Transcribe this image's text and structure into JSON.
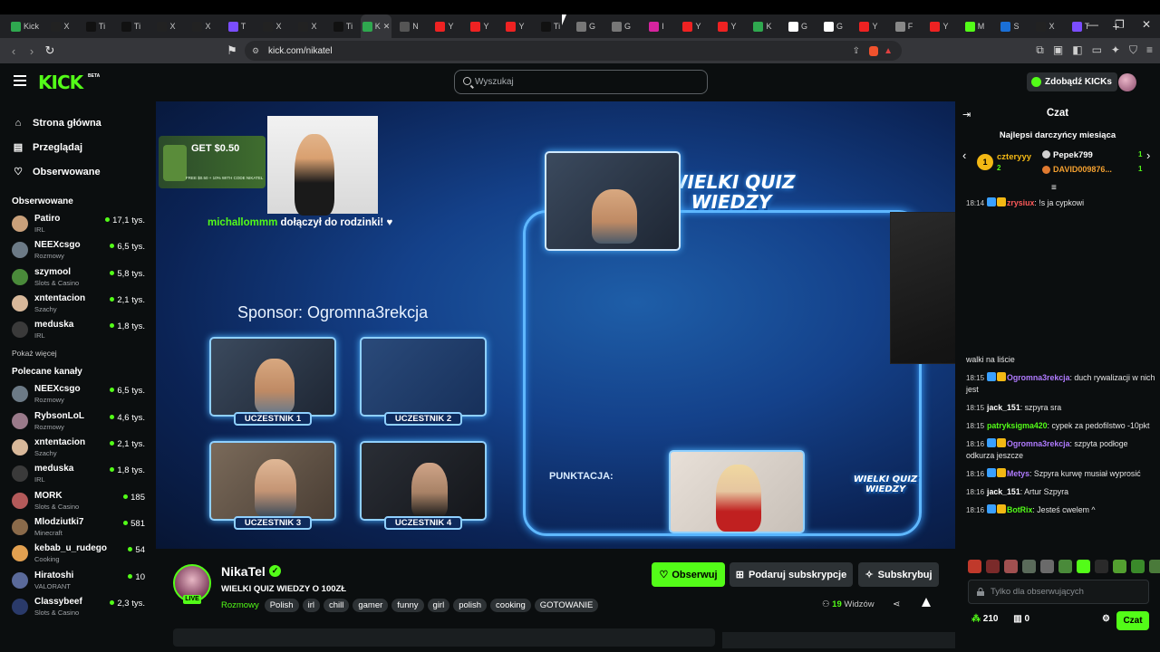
{
  "browser": {
    "tabs": [
      {
        "label": "Kick"
      },
      {
        "label": "X"
      },
      {
        "label": "Ti"
      },
      {
        "label": "Ti"
      },
      {
        "label": "X"
      },
      {
        "label": "X"
      },
      {
        "label": "T"
      },
      {
        "label": "X"
      },
      {
        "label": "X"
      },
      {
        "label": "Ti"
      },
      {
        "label": "K"
      },
      {
        "label": "N"
      },
      {
        "label": "Y"
      },
      {
        "label": "Y"
      },
      {
        "label": "Y"
      },
      {
        "label": "Ti"
      },
      {
        "label": "G"
      },
      {
        "label": "G"
      },
      {
        "label": "I"
      },
      {
        "label": "Y"
      },
      {
        "label": "Y"
      },
      {
        "label": "K"
      },
      {
        "label": "G"
      },
      {
        "label": "G"
      },
      {
        "label": "Y"
      },
      {
        "label": "F"
      },
      {
        "label": "Y"
      },
      {
        "label": "M"
      },
      {
        "label": "S"
      },
      {
        "label": "X"
      },
      {
        "label": "T"
      }
    ],
    "active_tab": "N",
    "new_tab": "+",
    "url": "kick.com/nikatel"
  },
  "header": {
    "logo": "KICK",
    "beta": "BETA",
    "search_placeholder": "Wyszukaj",
    "kicks_button": "Zdobądź KICKs"
  },
  "sidebar": {
    "main": [
      {
        "label": "Strona główna",
        "icon": "⌂"
      },
      {
        "label": "Przeglądaj",
        "icon": "▤"
      },
      {
        "label": "Obserwowane",
        "icon": "♡"
      }
    ],
    "followed_heading": "Obserwowane",
    "followed": [
      {
        "name": "Patiro",
        "category": "IRL",
        "viewers": "17,1 tys.",
        "color": "#c9a07a"
      },
      {
        "name": "NEEXcsgo",
        "category": "Rozmowy",
        "viewers": "6,5 tys.",
        "color": "#6c7a86"
      },
      {
        "name": "szymool",
        "category": "Slots & Casino",
        "viewers": "5,8 tys.",
        "color": "#4a8a3a"
      },
      {
        "name": "xntentacion",
        "category": "Szachy",
        "viewers": "2,1 tys.",
        "color": "#d8b89a"
      },
      {
        "name": "meduska",
        "category": "IRL",
        "viewers": "1,8 tys.",
        "color": "#3a3a3a"
      }
    ],
    "show_more": "Pokaż więcej",
    "recommended_heading": "Polecane kanały",
    "recommended": [
      {
        "name": "NEEXcsgo",
        "category": "Rozmowy",
        "viewers": "6,5 tys.",
        "color": "#6c7a86"
      },
      {
        "name": "RybsonLoL",
        "category": "Rozmowy",
        "viewers": "4,6 tys.",
        "color": "#9a7a8a"
      },
      {
        "name": "xntentacion",
        "category": "Szachy",
        "viewers": "2,1 tys.",
        "color": "#d8b89a"
      },
      {
        "name": "meduska",
        "category": "IRL",
        "viewers": "1,8 tys.",
        "color": "#3a3a3a"
      },
      {
        "name": "MORK",
        "category": "Slots & Casino",
        "viewers": "185",
        "color": "#b35a5a"
      },
      {
        "name": "Mlodziutki7",
        "category": "Minecraft",
        "viewers": "581",
        "color": "#8a6a4a"
      },
      {
        "name": "kebab_u_rudego",
        "category": "Cooking",
        "viewers": "54",
        "color": "#e2a050"
      },
      {
        "name": "Hiratoshi",
        "category": "VALORANT",
        "viewers": "10",
        "color": "#5a6a9a"
      },
      {
        "name": "Classybeef",
        "category": "Slots & Casino",
        "viewers": "2,3 tys.",
        "color": "#2a3a6a"
      }
    ]
  },
  "stream": {
    "overlay": {
      "promo_text": "GET $0.50",
      "promo_sub": "FREE $0.50 + 10% WITH CODE NIKATEL",
      "join_nick": "michallommm",
      "join_text": "dołączył do rodzinki! ♥",
      "sponsor": "Sponsor: Ogromna3rekcja",
      "logo_line1": "WIELKI QUIZ",
      "logo_line2": "WIEDZY",
      "contestants": [
        "UCZESTNIK 1",
        "UCZESTNIK 2",
        "UCZESTNIK 3",
        "UCZESTNIK 4"
      ],
      "score_label": "PUNKTACJA:"
    },
    "channel_name": "NikaTel",
    "live_label": "LIVE",
    "title": "WIELKI QUIZ WIEDZY O 100ZŁ",
    "category": "Rozmowy",
    "tags": [
      "Polish",
      "irl",
      "chill",
      "gamer",
      "funny",
      "girl",
      "polish",
      "cooking",
      "GOTOWANIE"
    ],
    "follow_button": "Obserwuj",
    "gift_button": "Podaruj subskrypcje",
    "subscribe_button": "Subskrybuj",
    "viewers_count": "19",
    "viewers_label": "Widzów"
  },
  "chat": {
    "title": "Czat",
    "donors_title": "Najlepsi darczyńcy miesiąca",
    "donors": [
      {
        "rank": "1",
        "name": "czteryyy",
        "amount": "2"
      },
      {
        "name": "Pepek799",
        "amount": "1"
      },
      {
        "name": "DAVID009876...",
        "amount": "1"
      }
    ],
    "messages": [
      {
        "time": "18:14",
        "nick": "zrysiux",
        "nick_color": "#ff5a5a",
        "text": "!s ja cypkowi"
      },
      {
        "time": "",
        "nick": "",
        "nick_color": "#ffffff",
        "text": "walki na liście"
      },
      {
        "time": "18:15",
        "nick": "Ogromna3rekcja",
        "nick_color": "#b07bff",
        "text": "duch rywalizacji w nich jest"
      },
      {
        "time": "18:15",
        "nick": "jack_151",
        "nick_color": "#ffffff",
        "text": "szpyra sra"
      },
      {
        "time": "18:15",
        "nick": "patryksigma420",
        "nick_color": "#53fc18",
        "text": "cypek za pedofilstwo -10pkt"
      },
      {
        "time": "18:16",
        "nick": "Ogromna3rekcja",
        "nick_color": "#b07bff",
        "text": "szpyta podłoge odkurza jeszcze"
      },
      {
        "time": "18:16",
        "nick": "Metys",
        "nick_color": "#b07bff",
        "text": "Szpyra kurwę musiał wyprosić"
      },
      {
        "time": "18:16",
        "nick": "jack_151",
        "nick_color": "#ffffff",
        "text": "Artur Szpyra"
      },
      {
        "time": "18:16",
        "nick": "BotRix",
        "nick_color": "#53fc18",
        "text": "Jesteś cwelem ^"
      }
    ],
    "input_placeholder": "Tylko dla obserwujących",
    "points": "210",
    "gifts": "0",
    "send_button": "Czat"
  }
}
